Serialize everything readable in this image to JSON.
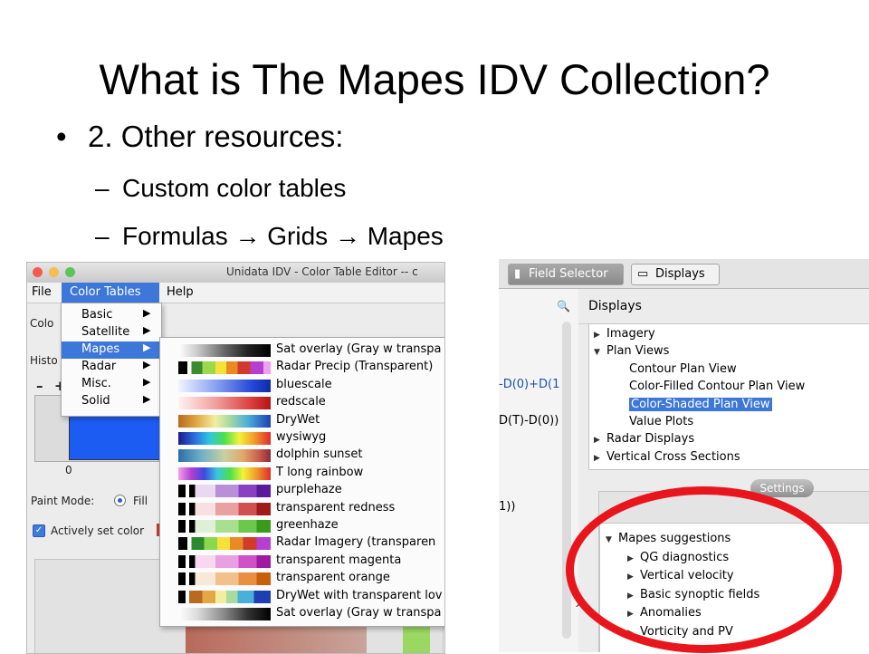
{
  "slide": {
    "title": "What is The Mapes IDV Collection?",
    "bullet_marker": "•",
    "bullet": "2. Other resources:",
    "sub_marker": "–",
    "sub1": "Custom color tables",
    "sub2_a": "Formulas",
    "sub2_arrow": "→",
    "sub2_b": "Grids",
    "sub2_c": "Mapes"
  },
  "left_window": {
    "title": "Unidata IDV - Color Table Editor -- c",
    "menu": {
      "file": "File",
      "color_tables": "Color Tables",
      "help": "Help"
    },
    "bg_labels": {
      "color_label": "Colo",
      "histo_label": "Histo",
      "minus": "–",
      "plus": "+",
      "zero": "0",
      "paint_mode": "Paint Mode:",
      "fill": "Fill",
      "actively_set": "Actively set color"
    },
    "dropdown": [
      {
        "label": "Basic",
        "arrow": "▶"
      },
      {
        "label": "Satellite",
        "arrow": "▶"
      },
      {
        "label": "Mapes",
        "arrow": "▶"
      },
      {
        "label": "Radar",
        "arrow": "▶"
      },
      {
        "label": "Misc.",
        "arrow": "▶"
      },
      {
        "label": "Solid",
        "arrow": "▶"
      }
    ],
    "color_tables": [
      {
        "label": "Sat overlay (Gray w transpa",
        "swatch": "checker-gray"
      },
      {
        "label": "Radar Precip (Transparent)",
        "swatch": "checker-radar"
      },
      {
        "label": "bluescale",
        "swatch": "blue"
      },
      {
        "label": "redscale",
        "swatch": "red"
      },
      {
        "label": "DryWet",
        "swatch": "drywet"
      },
      {
        "label": "wysiwyg",
        "swatch": "wysiwyg"
      },
      {
        "label": "dolphin sunset",
        "swatch": "dolphin"
      },
      {
        "label": "T long rainbow",
        "swatch": "rainbow"
      },
      {
        "label": "purplehaze",
        "swatch": "checker-purple"
      },
      {
        "label": "transparent redness",
        "swatch": "checker-red"
      },
      {
        "label": "greenhaze",
        "swatch": "checker-green"
      },
      {
        "label": "Radar Imagery (transparen",
        "swatch": "checker-radar2"
      },
      {
        "label": "transparent magenta",
        "swatch": "checker-magenta"
      },
      {
        "label": "transparent orange",
        "swatch": "checker-orange"
      },
      {
        "label": "DryWet with transparent lov",
        "swatch": "checker-drywet"
      },
      {
        "label": "Sat overlay (Gray w transpa",
        "swatch": "checker-gray2"
      }
    ]
  },
  "right_window": {
    "tabs": {
      "field_selector": "Field Selector",
      "displays": "Displays"
    },
    "panel_title": "Displays",
    "left_fragments": [
      "-D(0)+D(1",
      "D(T)-D(0))",
      "1))"
    ],
    "tree": [
      {
        "label": "Imagery",
        "marker": "▶",
        "level": 0
      },
      {
        "label": "Plan Views",
        "marker": "▼",
        "level": 0
      },
      {
        "label": "Contour Plan View",
        "marker": "",
        "level": 1
      },
      {
        "label": "Color-Filled Contour Plan View",
        "marker": "",
        "level": 1
      },
      {
        "label": "Color-Shaded Plan View",
        "marker": "",
        "level": 1,
        "selected": true
      },
      {
        "label": "Value Plots",
        "marker": "",
        "level": 1
      },
      {
        "label": "Radar Displays",
        "marker": "▶",
        "level": 0
      },
      {
        "label": "Vertical Cross Sections",
        "marker": "▶",
        "level": 0
      }
    ],
    "settings_button": "Settings",
    "suggestions": [
      {
        "label": "Mapes suggestions",
        "marker": "▼",
        "level": 0
      },
      {
        "label": "QG diagnostics",
        "marker": "▶",
        "level": 1
      },
      {
        "label": "Vertical velocity",
        "marker": "▶",
        "level": 1
      },
      {
        "label": "Basic synoptic fields",
        "marker": "▶",
        "level": 1
      },
      {
        "label": "Anomalies",
        "marker": "▶",
        "level": 1
      },
      {
        "label": "Vorticity and PV",
        "marker": "▶",
        "level": 1
      }
    ]
  },
  "colors": {
    "menu_highlight": "#3d77d9",
    "circle": "#e8151c",
    "color_box": "#1d5cf2"
  }
}
